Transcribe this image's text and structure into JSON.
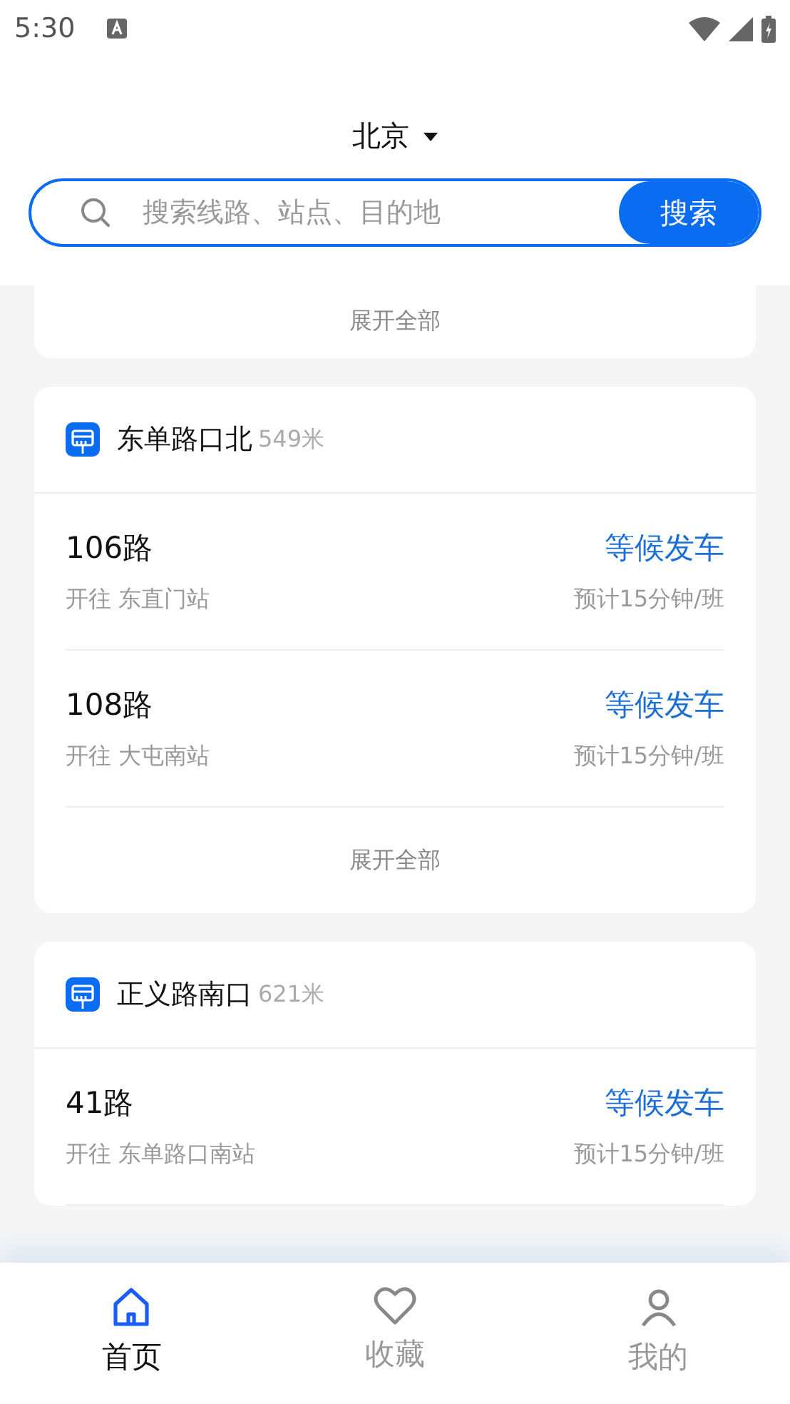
{
  "status_bar": {
    "time": "5:30"
  },
  "header": {
    "city": "北京",
    "search": {
      "placeholder": "搜索线路、站点、目的地",
      "button": "搜索"
    }
  },
  "stations": [
    {
      "expand_label": "展开全部"
    },
    {
      "name": "东单路口北",
      "distance": "549米",
      "routes": [
        {
          "name": "106路",
          "status": "等候发车",
          "direction": "开往 东直门站",
          "interval": "预计15分钟/班"
        },
        {
          "name": "108路",
          "status": "等候发车",
          "direction": "开往 大屯南站",
          "interval": "预计15分钟/班"
        }
      ],
      "expand_label": "展开全部"
    },
    {
      "name": "正义路南口",
      "distance": "621米",
      "routes": [
        {
          "name": "41路",
          "status": "等候发车",
          "direction": "开往 东单路口南站",
          "interval": "预计15分钟/班"
        }
      ]
    }
  ],
  "tabs": [
    {
      "label": "首页",
      "kind": "home",
      "selected": true
    },
    {
      "label": "收藏",
      "kind": "heart",
      "selected": false
    },
    {
      "label": "我的",
      "kind": "person",
      "selected": false
    }
  ]
}
